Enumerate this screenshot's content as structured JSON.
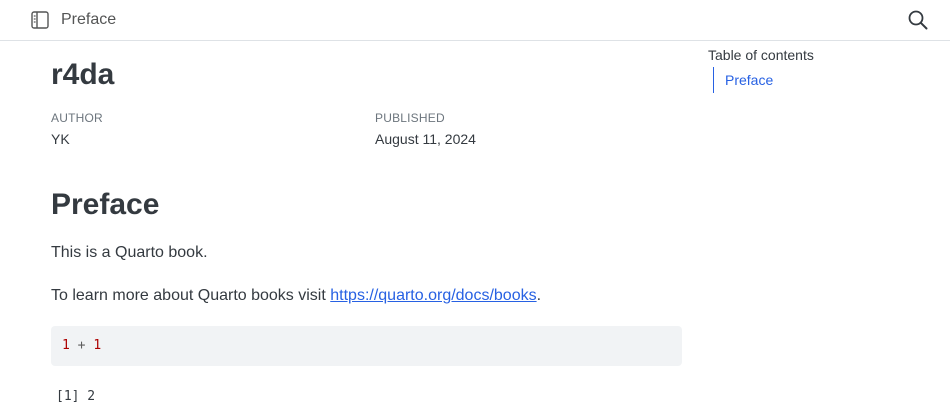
{
  "topbar": {
    "title": "Preface",
    "sidebar_icon": "sidebar-toggle-icon",
    "search_icon": "search-icon"
  },
  "document": {
    "title": "r4da",
    "author_heading": "AUTHOR",
    "author": "YK",
    "published_heading": "PUBLISHED",
    "published": "August 11, 2024"
  },
  "section": {
    "title": "Preface",
    "paragraph1": "This is a Quarto book.",
    "paragraph2_prefix": "To learn more about Quarto books visit ",
    "link_text": "https://quarto.org/docs/books",
    "paragraph2_suffix": "."
  },
  "code": {
    "left": "1",
    "operator": "+",
    "right": "1",
    "output": "[1] 2"
  },
  "toc": {
    "title": "Table of contents",
    "items": [
      {
        "label": "Preface"
      }
    ]
  },
  "colors": {
    "link": "#2761e3",
    "code_bg": "#f1f3f5",
    "code_number": "#ad0000",
    "text": "#343a40"
  }
}
